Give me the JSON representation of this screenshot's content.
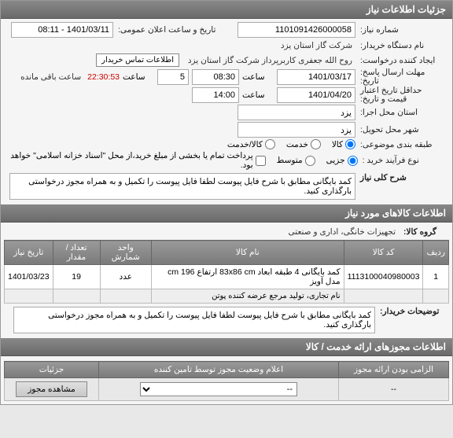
{
  "header": {
    "title": "جزئیات اطلاعات نیاز"
  },
  "form": {
    "req_no_label": "شماره نیاز:",
    "req_no": "1101091426000058",
    "ann_date_label": "تاریخ و ساعت اعلان عمومی:",
    "ann_date": "1401/03/11 - 08:11",
    "buyer_label": "نام دستگاه خریدار:",
    "buyer": "شرکت گاز استان یزد",
    "creator_label": "ایجاد کننده درخواست:",
    "creator": "روح الله جعفری کاربرپرداز شرکت گاز استان یزد",
    "contact_btn": "اطلاعات تماس خریدار",
    "deadline_label": "مهلت ارسال پاسخ:",
    "deadline_sub": "تاریخ:",
    "deadline_date": "1401/03/17",
    "time_label": "ساعت",
    "deadline_time": "08:30",
    "days_remain": "5",
    "countdown": "22:30:53",
    "remain_suffix": "ساعت باقی مانده",
    "validity_label": "حداقل تاریخ اعتبار",
    "validity_sub": "قیمت و تاریخ:",
    "validity_date": "1401/04/20",
    "validity_time": "14:00",
    "exec_loc_label": "استان محل اجرا:",
    "exec_loc": "یزد",
    "deliv_loc_label": "شهر محل تحویل:",
    "deliv_loc": "یزد",
    "cat_label": "طبقه بندی موضوعی:",
    "cat_goods": "کالا",
    "cat_service": "خدمت",
    "cat_goods_service": "کالا/خدمت",
    "proc_label": "نوع فرآیند خرید :",
    "proc_partial": "جزیی",
    "proc_medium": "متوسط",
    "proc_note": "پرداخت تمام یا بخشی از مبلغ خرید،از محل \"اسناد خزانه اسلامی\" خواهد بود.",
    "desc_label": "شرح کلی نیاز",
    "desc_text": "کمد بایگانی مطابق با شرح فایل پیوست لطفا فایل پیوست را تکمیل و به همراه مجوز درخواستی بارگذاری کنید."
  },
  "goods": {
    "header": "اطلاعات کالاهای مورد نیاز",
    "group_label": "گروه کالا:",
    "group": "تجهیزات خانگی، اداری و صنعتی",
    "cols": {
      "row": "ردیف",
      "code": "کد کالا",
      "name": "نام کالا",
      "unit": "واحد شمارش",
      "qty": "تعداد / مقدار",
      "date": "تاریخ نیاز"
    },
    "items": [
      {
        "row": "1",
        "code": "1113100040980003",
        "name": "کمد بایگانی 4 طبقه ابعاد 83x86 cm ارتفاع 196 cm مدل آویز",
        "unit": "عدد",
        "qty": "19",
        "date": "1401/03/23",
        "sub": "نام تجاری، تولید مرجع عرضه کننده پوتن"
      }
    ],
    "buyer_note_label": "توضیحات خریدار:",
    "buyer_note": "کمد بایگانی مطابق با شرح فایل پیوست لطفا فایل پیوست را تکمیل و به همراه مجوز درخواستی بارگذاری کنید."
  },
  "permits": {
    "header": "اطلاعات مجوزهای ارائه خدمت / کالا",
    "cols": {
      "mandatory": "الزامی بودن ارائه مجوز",
      "status": "اعلام وضعیت مجوز توسط تامین کننده",
      "details": "جزئیات"
    },
    "mandatory_val": "--",
    "status_opt": "--",
    "view_btn": "مشاهده مجوز"
  }
}
